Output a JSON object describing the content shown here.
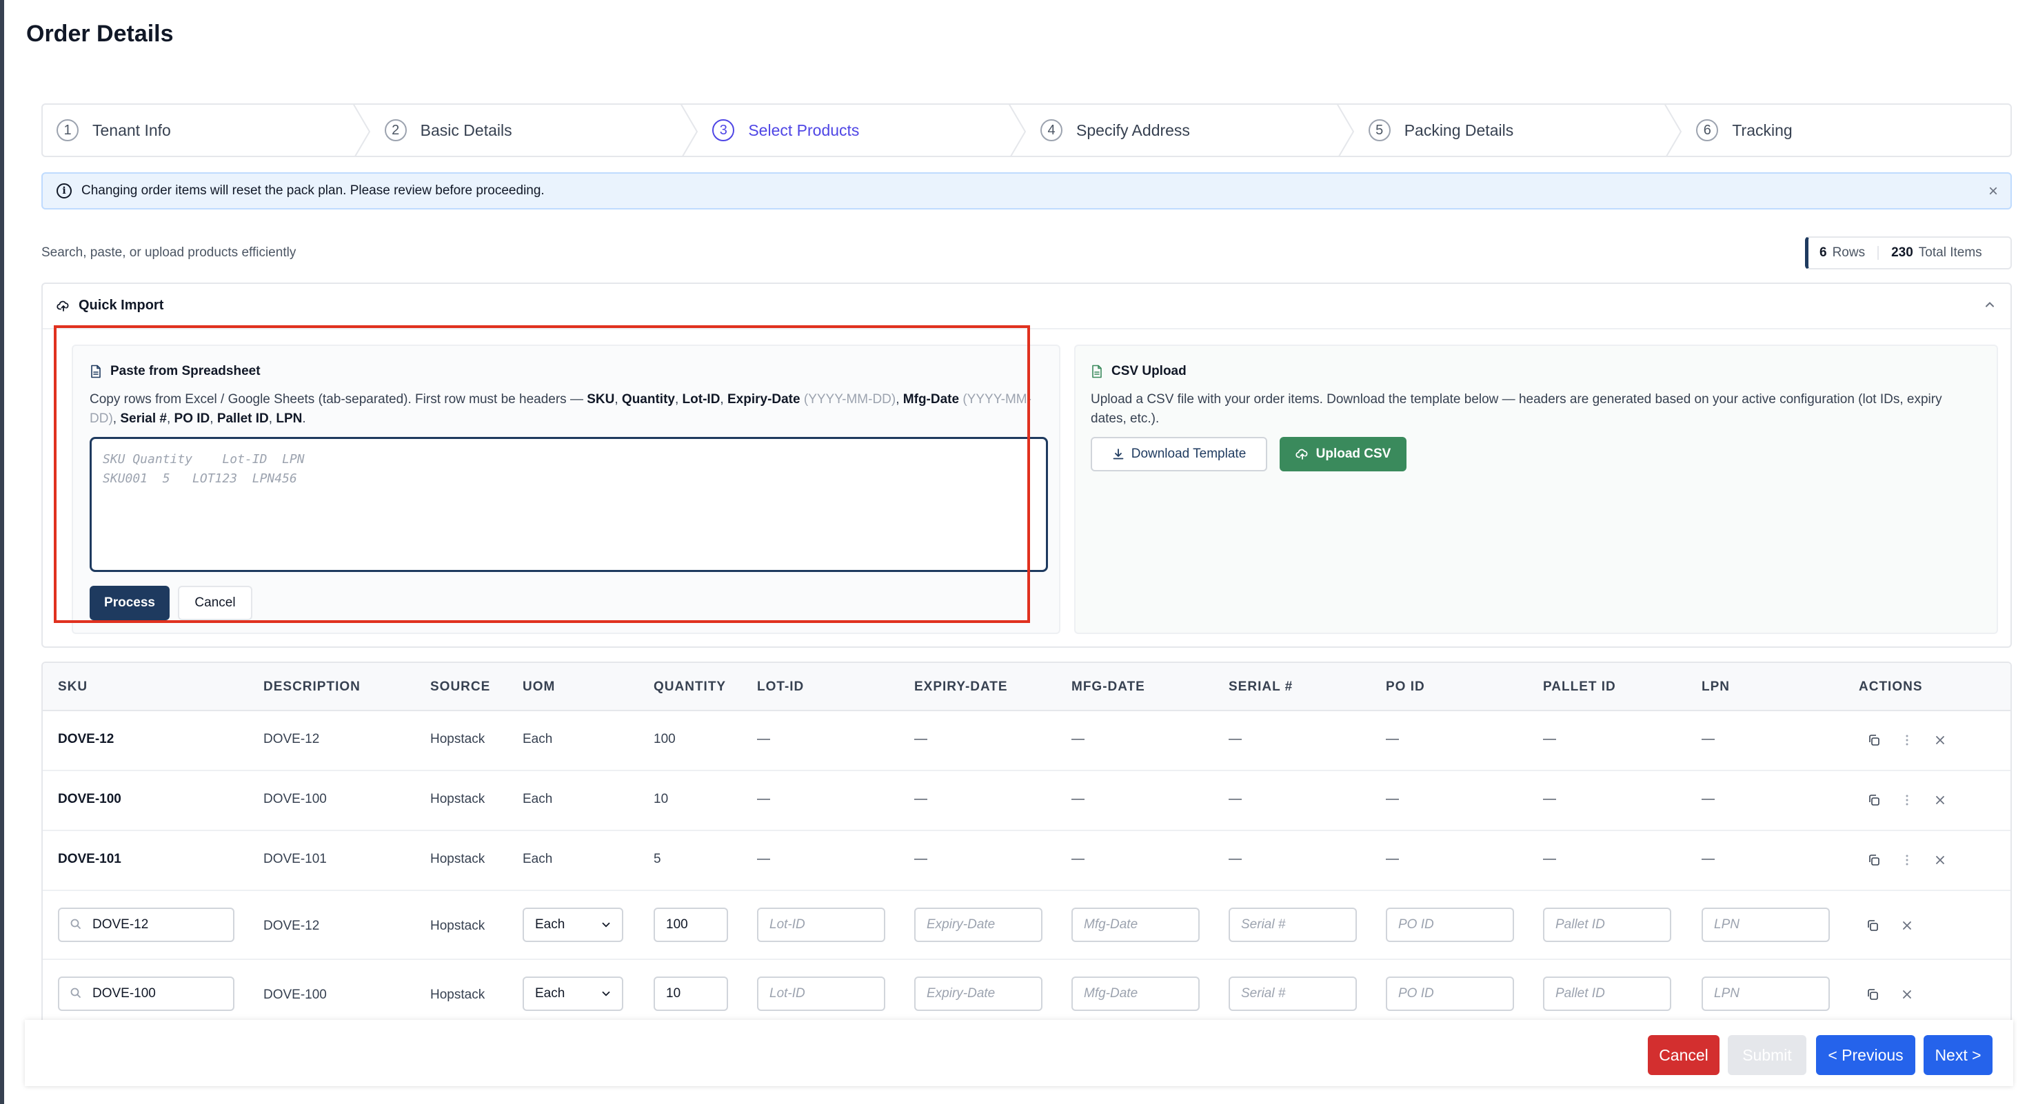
{
  "page": {
    "title": "Order Details"
  },
  "stepper": {
    "steps": [
      {
        "num": "1",
        "label": "Tenant Info"
      },
      {
        "num": "2",
        "label": "Basic Details"
      },
      {
        "num": "3",
        "label": "Select Products",
        "active": true
      },
      {
        "num": "4",
        "label": "Specify Address"
      },
      {
        "num": "5",
        "label": "Packing Details"
      },
      {
        "num": "6",
        "label": "Tracking"
      }
    ]
  },
  "alert": {
    "text": "Changing order items will reset the pack plan. Please review before proceeding."
  },
  "subtitle": "Search, paste, or upload products efficiently",
  "counts": {
    "rows": "6",
    "rows_label": "Rows",
    "items": "230",
    "items_label": "Total Items"
  },
  "quick_import": {
    "title": "Quick Import",
    "paste": {
      "title": "Paste from Spreadsheet",
      "desc_prefix": "Copy rows from Excel / Google Sheets (tab-separated). First row must be headers — ",
      "h_sku": "SKU",
      "h_qty": "Quantity",
      "h_lot": "Lot-ID",
      "h_exp": "Expiry-Date",
      "h_exp_fmt": "(YYYY-MM-DD)",
      "h_mfg": "Mfg-Date",
      "h_mfg_fmt": "(YYYY-MM-DD)",
      "h_serial": "Serial #",
      "h_po": "PO ID",
      "h_pallet": "Pallet ID",
      "h_lpn": "LPN",
      "placeholder_line1": "SKU Quantity    Lot-ID  LPN",
      "placeholder_line2": "SKU001  5   LOT123  LPN456",
      "process_label": "Process",
      "cancel_label": "Cancel"
    },
    "csv": {
      "title": "CSV Upload",
      "desc": "Upload a CSV file with your order items. Download the template below — headers are generated based on your active configuration (lot IDs, expiry dates, etc.).",
      "download_label": "Download Template",
      "upload_label": "Upload CSV"
    }
  },
  "table": {
    "headers": [
      "SKU",
      "DESCRIPTION",
      "SOURCE",
      "UOM",
      "QUANTITY",
      "LOT-ID",
      "EXPIRY-DATE",
      "MFG-DATE",
      "SERIAL #",
      "PO ID",
      "PALLET ID",
      "LPN",
      "ACTIONS"
    ],
    "static_rows": [
      {
        "sku": "DOVE-12",
        "description": "DOVE-12",
        "source": "Hopstack",
        "uom": "Each",
        "quantity": "100",
        "lot": "—",
        "expiry": "—",
        "mfg": "—",
        "serial": "—",
        "po": "—",
        "pallet": "—",
        "lpn": "—"
      },
      {
        "sku": "DOVE-100",
        "description": "DOVE-100",
        "source": "Hopstack",
        "uom": "Each",
        "quantity": "10",
        "lot": "—",
        "expiry": "—",
        "mfg": "—",
        "serial": "—",
        "po": "—",
        "pallet": "—",
        "lpn": "—"
      },
      {
        "sku": "DOVE-101",
        "description": "DOVE-101",
        "source": "Hopstack",
        "uom": "Each",
        "quantity": "5",
        "lot": "—",
        "expiry": "—",
        "mfg": "—",
        "serial": "—",
        "po": "—",
        "pallet": "—",
        "lpn": "—"
      }
    ],
    "edit_rows": [
      {
        "sku": "DOVE-12",
        "description": "DOVE-12",
        "source": "Hopstack",
        "uom": "Each",
        "quantity": "100"
      },
      {
        "sku": "DOVE-100",
        "description": "DOVE-100",
        "source": "Hopstack",
        "uom": "Each",
        "quantity": "10"
      }
    ],
    "placeholders": {
      "lot": "Lot-ID",
      "expiry": "Expiry-Date",
      "mfg": "Mfg-Date",
      "serial": "Serial #",
      "po": "PO ID",
      "pallet": "Pallet ID",
      "lpn": "LPN"
    }
  },
  "footer": {
    "cancel": "Cancel",
    "submit": "Submit",
    "previous": "< Previous",
    "next": "Next >"
  },
  "colors": {
    "primary_navy": "#1e3a5f",
    "accent_indigo": "#4f46e5",
    "success_green": "#3a8a5c",
    "danger_red": "#d32f2f",
    "nav_blue": "#2563eb",
    "highlight_red": "#e0311f"
  },
  "icons": [
    "info-icon",
    "close-icon",
    "upload-cloud-icon",
    "chevron-up-icon",
    "document-icon",
    "csv-file-icon",
    "download-icon",
    "search-icon",
    "chevron-down-icon",
    "copy-icon",
    "more-vertical-icon"
  ]
}
